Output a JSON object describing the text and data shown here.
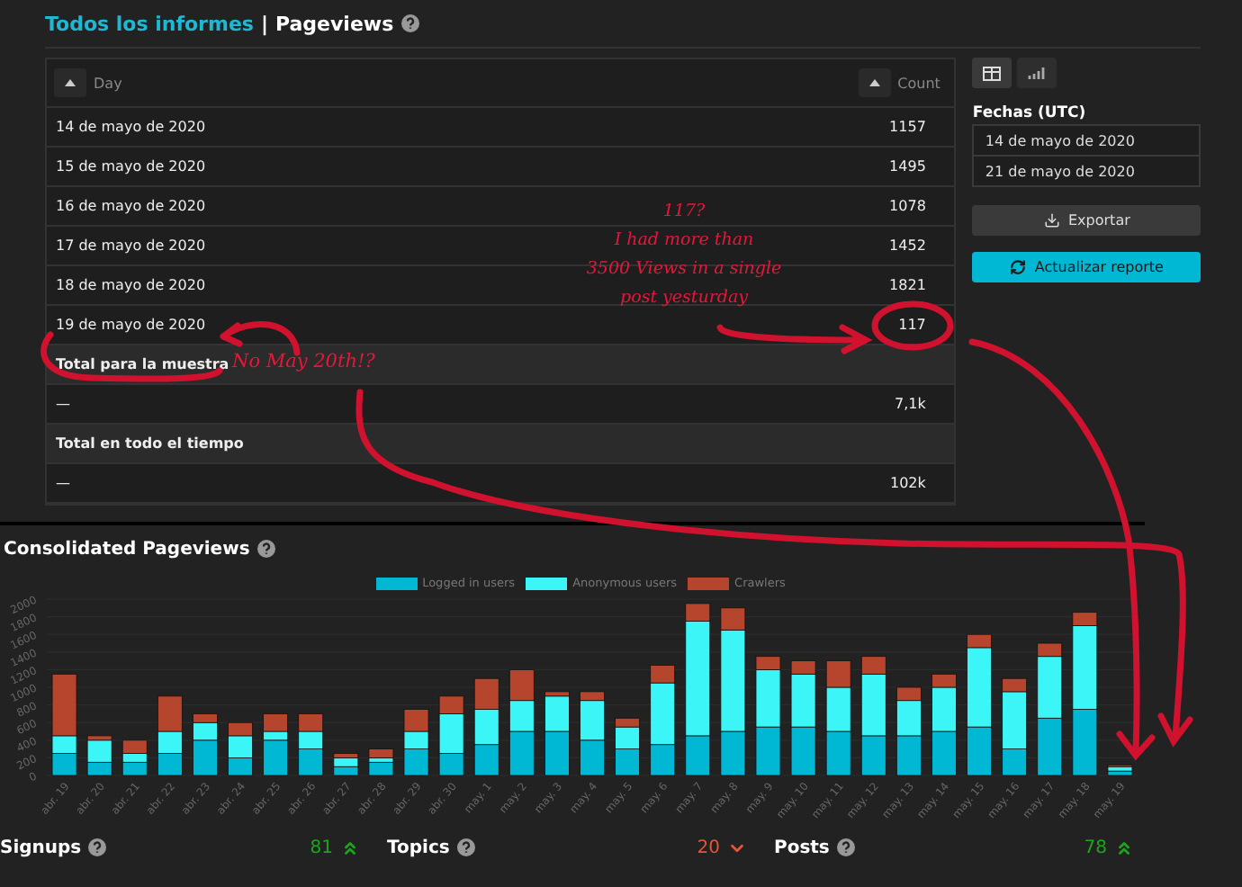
{
  "header": {
    "breadcrumb": "Todos los informes",
    "separator": "|",
    "title": "Pageviews"
  },
  "table": {
    "columns": [
      {
        "label": "Day"
      },
      {
        "label": "Count"
      }
    ],
    "rows": [
      {
        "kind": "data",
        "cells": [
          "14 de mayo de 2020",
          "1157"
        ]
      },
      {
        "kind": "data",
        "cells": [
          "15 de mayo de 2020",
          "1495"
        ]
      },
      {
        "kind": "data",
        "cells": [
          "16 de mayo de 2020",
          "1078"
        ]
      },
      {
        "kind": "data",
        "cells": [
          "17 de mayo de 2020",
          "1452"
        ]
      },
      {
        "kind": "data",
        "cells": [
          "18 de mayo de 2020",
          "1821"
        ]
      },
      {
        "kind": "data",
        "cells": [
          "19 de mayo de 2020",
          "117"
        ]
      },
      {
        "kind": "heading",
        "cells": [
          "Total para la muestra"
        ]
      },
      {
        "kind": "data",
        "cells": [
          "—",
          "7,1k"
        ]
      },
      {
        "kind": "heading",
        "cells": [
          "Total en todo el tiempo"
        ]
      },
      {
        "kind": "data",
        "cells": [
          "—",
          "102k"
        ]
      }
    ]
  },
  "side_panel": {
    "view_buttons": [
      {
        "kind": "table",
        "selected": true
      },
      {
        "kind": "chart",
        "selected": false
      }
    ],
    "dates_label": "Fechas (UTC)",
    "dates": [
      "14 de mayo de 2020",
      "21 de mayo de 2020"
    ],
    "export_button": "Exportar",
    "refresh_button": "Actualizar reporte"
  },
  "chart_section": {
    "title": "Consolidated Pageviews",
    "chart_data": {
      "type": "bar",
      "stacked": true,
      "grid": true,
      "categories": [
        "abr. 19",
        "abr. 20",
        "abr. 21",
        "abr. 22",
        "abr. 23",
        "abr. 24",
        "abr. 25",
        "abr. 26",
        "abr. 27",
        "abr. 28",
        "abr. 29",
        "abr. 30",
        "may. 1",
        "may. 2",
        "may. 3",
        "may. 4",
        "may. 5",
        "may. 6",
        "may. 7",
        "may. 8",
        "may. 9",
        "may. 10",
        "may. 11",
        "may. 12",
        "may. 13",
        "may. 14",
        "may. 15",
        "may. 16",
        "may. 17",
        "may. 18",
        "may. 19"
      ],
      "series": [
        {
          "name": "Logged in users",
          "color": "#00b8d4",
          "values": [
            250,
            150,
            150,
            250,
            400,
            200,
            400,
            300,
            100,
            150,
            300,
            250,
            350,
            500,
            500,
            400,
            300,
            350,
            450,
            500,
            550,
            550,
            500,
            450,
            450,
            500,
            550,
            300,
            650,
            750,
            50
          ]
        },
        {
          "name": "Anonymous users",
          "color": "#3bf5f7",
          "values": [
            200,
            250,
            100,
            250,
            200,
            250,
            100,
            200,
            100,
            50,
            200,
            450,
            400,
            350,
            400,
            450,
            250,
            700,
            1300,
            1150,
            650,
            600,
            500,
            700,
            400,
            500,
            900,
            650,
            700,
            950,
            50
          ]
        },
        {
          "name": "Crawlers",
          "color": "#b5452c",
          "values": [
            700,
            50,
            150,
            400,
            100,
            150,
            200,
            200,
            50,
            100,
            250,
            200,
            350,
            350,
            50,
            100,
            100,
            200,
            200,
            250,
            150,
            150,
            300,
            200,
            150,
            150,
            150,
            150,
            150,
            150,
            20
          ]
        }
      ],
      "ylim": [
        0,
        2000
      ],
      "yticks": [
        0,
        200,
        400,
        600,
        800,
        1000,
        1200,
        1400,
        1600,
        1800,
        2000
      ]
    }
  },
  "stats": [
    {
      "label": "Signups",
      "value": "81",
      "trend_up": true,
      "color": "#1ca51c"
    },
    {
      "label": "Topics",
      "value": "20",
      "trend_up": false,
      "color": "#e45735"
    },
    {
      "label": "Posts",
      "value": "78",
      "trend_up": true,
      "color": "#1ca51c"
    }
  ],
  "annotations": {
    "note_lines": [
      "117?",
      "I had more than",
      "3500 Views in a single",
      "post yesturday"
    ],
    "note_missing": "No May 20th!?"
  }
}
